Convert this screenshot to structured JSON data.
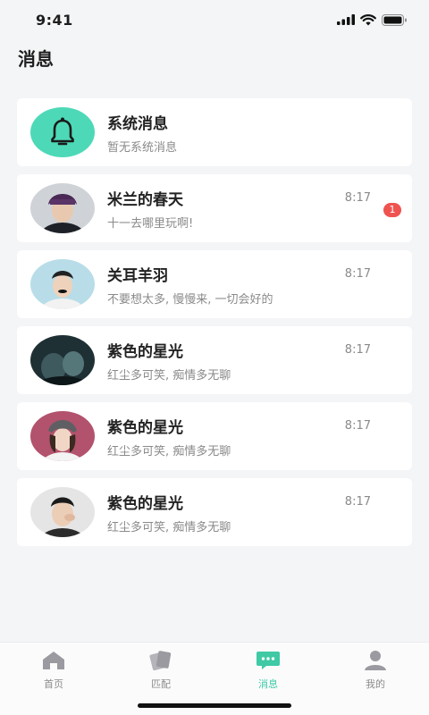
{
  "status": {
    "time": "9:41"
  },
  "header": {
    "title": "消息"
  },
  "system": {
    "name": "系统消息",
    "subtitle": "暂无系统消息"
  },
  "messages": [
    {
      "name": "米兰的春天",
      "time": "8:17",
      "preview": "十一去哪里玩啊!",
      "unread": "1"
    },
    {
      "name": "关耳羊羽",
      "time": "8:17",
      "preview": "不要想太多, 慢慢来, 一切会好的"
    },
    {
      "name": "紫色的星光",
      "time": "8:17",
      "preview": "红尘多可笑, 痴情多无聊"
    },
    {
      "name": "紫色的星光",
      "time": "8:17",
      "preview": "红尘多可笑, 痴情多无聊"
    },
    {
      "name": "紫色的星光",
      "time": "8:17",
      "preview": "红尘多可笑, 痴情多无聊"
    }
  ],
  "tabs": [
    {
      "label": "首页",
      "icon": "home-icon"
    },
    {
      "label": "匹配",
      "icon": "cards-icon"
    },
    {
      "label": "消息",
      "icon": "chat-icon",
      "active": true
    },
    {
      "label": "我的",
      "icon": "user-icon"
    }
  ],
  "colors": {
    "accent": "#3fc9a5",
    "bell_bg": "#4dd9b7",
    "badge": "#ef5350"
  }
}
